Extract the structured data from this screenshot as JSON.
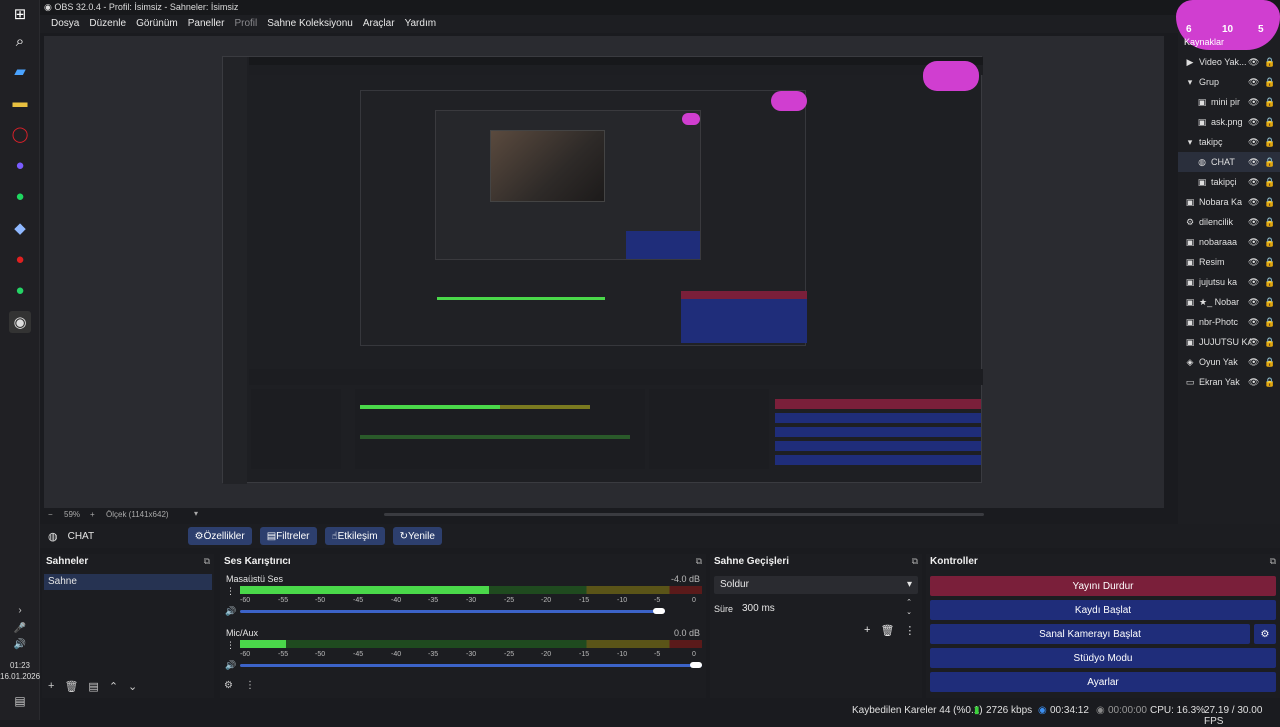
{
  "window": {
    "title": "OBS 32.0.4 - Profil: İsimsiz - Sahneler: İsimsiz"
  },
  "menu": [
    "Dosya",
    "Düzenle",
    "Görünüm",
    "Paneller",
    "Profil",
    "Sahne Koleksiyonu",
    "Araçlar",
    "Yardım"
  ],
  "preview": {
    "zoom": "59%",
    "scale": "Ölçek (1141x642)"
  },
  "source_toolbar": {
    "selected": "CHAT",
    "properties": "Özellikler",
    "filters": "Filtreler",
    "interact": "Etkileşim",
    "refresh": "Yenile"
  },
  "sources": {
    "title": "Kaynaklar",
    "badge": {
      "a": "6",
      "b": "10",
      "c": "5"
    },
    "items": [
      {
        "label": "Video Yak...",
        "icon": "video-icon"
      },
      {
        "label": "Grup",
        "icon": "folder-icon"
      },
      {
        "label": "mini pir",
        "icon": "image-icon"
      },
      {
        "label": "ask.png",
        "icon": "image-icon"
      },
      {
        "label": "takipç",
        "icon": "folder-icon"
      },
      {
        "label": "CHAT",
        "icon": "browser-icon"
      },
      {
        "label": "takipçi",
        "icon": "image-icon"
      },
      {
        "label": "Nobara Ka",
        "icon": "image-icon"
      },
      {
        "label": "dilencilik",
        "icon": "settings-icon"
      },
      {
        "label": "nobaraaa",
        "icon": "image-icon"
      },
      {
        "label": "Resim",
        "icon": "image-icon"
      },
      {
        "label": "jujutsu ka",
        "icon": "image-icon"
      },
      {
        "label": "★_ Nobar",
        "icon": "image-icon"
      },
      {
        "label": "nbr-Photc",
        "icon": "image-icon"
      },
      {
        "label": "JUJUTSU KAI",
        "icon": "image-icon"
      },
      {
        "label": "Oyun Yak",
        "icon": "game-icon"
      },
      {
        "label": "Ekran Yak",
        "icon": "monitor-icon"
      }
    ]
  },
  "scenes": {
    "title": "Sahneler",
    "items": [
      "Sahne"
    ]
  },
  "mixer": {
    "title": "Ses Karıştırıcı",
    "channels": [
      {
        "name": "Masaüstü Ses",
        "db": "-4.0 dB",
        "level": 0.54,
        "volume": 0.92
      },
      {
        "name": "Mic/Aux",
        "db": "0.0 dB",
        "level": 0.1,
        "volume": 1.0
      }
    ],
    "ticks": [
      "-60",
      "-55",
      "-50",
      "-45",
      "-40",
      "-35",
      "-30",
      "-25",
      "-20",
      "-15",
      "-10",
      "-5",
      "0"
    ]
  },
  "transitions": {
    "title": "Sahne Geçişleri",
    "type": "Soldur",
    "duration_label": "Süre",
    "duration": "300 ms"
  },
  "controls": {
    "title": "Kontroller",
    "buttons": [
      "Yayını Durdur",
      "Kaydı Başlat",
      "Sanal Kamerayı Başlat",
      "Stüdyo Modu",
      "Ayarlar"
    ]
  },
  "status": {
    "dropped": "Kaybedilen Kareler 44 (%0.1)",
    "bitrate": "2726 kbps",
    "stream_time": "00:34:12",
    "rec_time": "00:00:00",
    "cpu": "CPU: 16.3%",
    "fps": "27.19 / 30.00 FPS"
  },
  "clock": {
    "time": "01:23",
    "date": "16.01.2026"
  },
  "colors": {
    "stop_stream": "#7a1f3a",
    "control_blue": "#1f2d7a",
    "accent_pink": "#d03ed0"
  }
}
